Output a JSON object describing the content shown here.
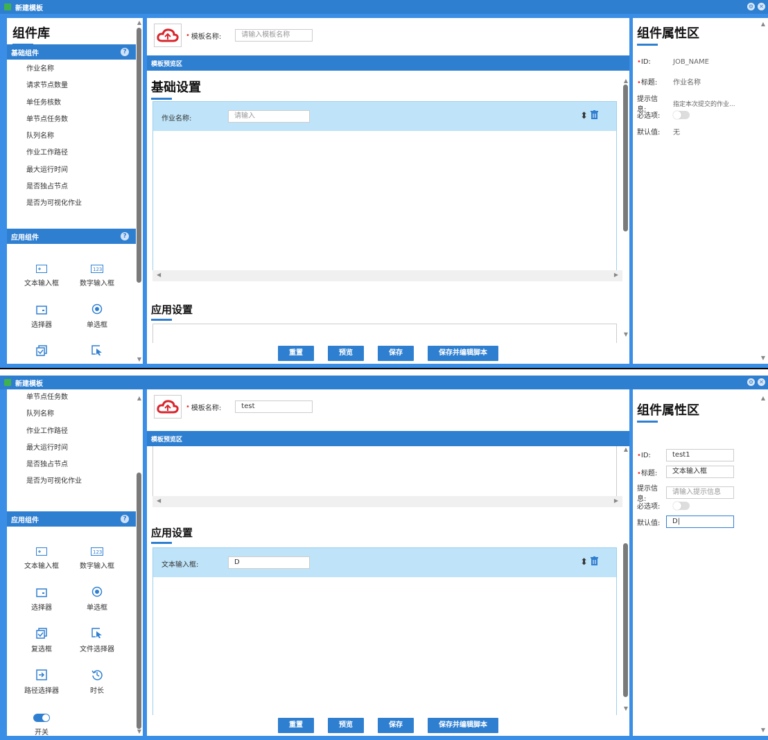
{
  "window": {
    "title": "新建模板"
  },
  "left": {
    "heading": "组件库",
    "basic_section": "基础组件",
    "basic_items": [
      "作业名称",
      "请求节点数量",
      "单任务核数",
      "单节点任务数",
      "队列名称",
      "作业工作路径",
      "最大运行时间",
      "是否独占节点",
      "是否为可视化作业"
    ],
    "basic_items_scrolled": [
      "单节点任务数",
      "队列名称",
      "作业工作路径",
      "最大运行时间",
      "是否独占节点",
      "是否为可视化作业"
    ],
    "app_section": "应用组件",
    "app_items": [
      {
        "label": "文本输入框",
        "icon": "text-input-icon"
      },
      {
        "label": "数字输入框",
        "icon": "number-input-icon"
      },
      {
        "label": "选择器",
        "icon": "select-icon"
      },
      {
        "label": "单选框",
        "icon": "radio-icon"
      },
      {
        "label": "复选框",
        "icon": "checkbox-icon"
      },
      {
        "label": "文件选择器",
        "icon": "file-picker-icon"
      },
      {
        "label": "路径选择器",
        "icon": "path-picker-icon"
      },
      {
        "label": "时长",
        "icon": "duration-icon"
      },
      {
        "label": "开关",
        "icon": "switch-icon"
      }
    ]
  },
  "center": {
    "template_name_label": "模板名称:",
    "template_name_placeholder": "请输入模板名称",
    "template_name_value": "test",
    "preview_bar": "模板预览区",
    "basic_settings": "基础设置",
    "app_settings": "应用设置",
    "field1_label": "作业名称:",
    "field1_placeholder": "请输入",
    "field2_label": "文本输入框:",
    "field2_value": "D",
    "buttons": {
      "reset": "重置",
      "preview": "预览",
      "save": "保存",
      "save_edit": "保存并编辑脚本"
    }
  },
  "right": {
    "heading": "组件属性区",
    "w1": {
      "id_label": "ID:",
      "id_value": "JOB_NAME",
      "title_label": "标题:",
      "title_value": "作业名称",
      "hint_label": "提示信息:",
      "hint_value": "指定本次提交的作业...",
      "required_label": "必选项:",
      "default_label": "默认值:",
      "default_value": "无"
    },
    "w2": {
      "id_value": "test1",
      "title_value": "文本输入框",
      "hint_placeholder": "请输入提示信息",
      "default_value": "D|"
    }
  },
  "colors": {
    "accent": "#2f7fd1",
    "row_highlight": "#bfe3f8"
  }
}
